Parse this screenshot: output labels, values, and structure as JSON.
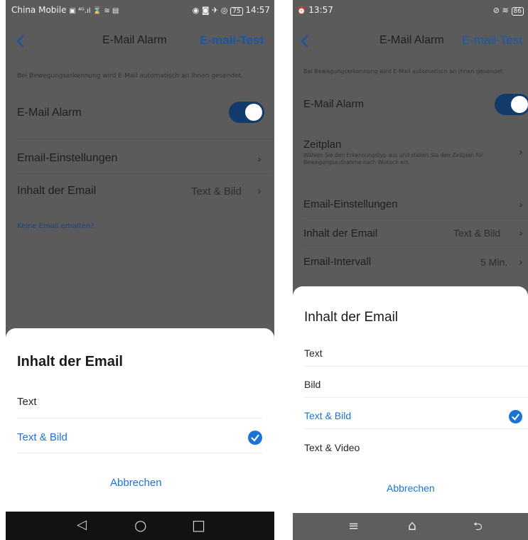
{
  "left": {
    "status": {
      "carrier": "China Mobile",
      "carrier_icons": "▣ ⁴ᴳ.ıl ⌛ ≋ ▤",
      "right_icons": "◉ ◙ ✈ ◎",
      "battery": "75",
      "time": "14:57"
    },
    "nav": {
      "title": "E-Mail Alarm",
      "action": "E-mail-Test"
    },
    "description": "Bei Bewegungserkennung wird E-Mail automatisch an Ihnen gesendet.",
    "alarm_label": "E-Mail Alarm",
    "rows": [
      {
        "label": "Email-Einstellungen",
        "value": ""
      },
      {
        "label": "Inhalt der Email",
        "value": "Text & Bild"
      }
    ],
    "link": "Keine Email erhalten?",
    "sheet": {
      "title": "Inhalt der Email",
      "options": [
        {
          "label": "Text",
          "selected": false
        },
        {
          "label": "Text & Bild",
          "selected": true
        }
      ],
      "cancel": "Abbrechen"
    },
    "sysnav": {
      "back": "◁",
      "home": "○",
      "recent": "□"
    }
  },
  "right": {
    "status": {
      "time": "13:57",
      "right_icons": "⊘ ≋",
      "battery": "86"
    },
    "nav": {
      "title": "E-Mail Alarm",
      "action": "E-mail-Test"
    },
    "description": "Bei Bewegungserkennung wird E-Mail automatisch an Ihnen gesendet.",
    "alarm_label": "E-Mail Alarm",
    "schedule": {
      "label": "Zeitplan",
      "subtitle": "Wählen Sie den Erkennungstyp aus und stellen Sie den Zeitplan für Bewegungsaufnahme nach Wunsch ein."
    },
    "rows": [
      {
        "label": "Email-Einstellungen",
        "value": ""
      },
      {
        "label": "Inhalt der Email",
        "value": "Text & Bild"
      },
      {
        "label": "Email-Intervall",
        "value": "5 Min."
      }
    ],
    "sheet": {
      "title": "Inhalt der Email",
      "options": [
        {
          "label": "Text",
          "selected": false
        },
        {
          "label": "Bild",
          "selected": false
        },
        {
          "label": "Text & Bild",
          "selected": true
        },
        {
          "label": "Text & Video",
          "selected": false
        }
      ],
      "cancel": "Abbrechen"
    },
    "sysnav": {
      "menu": "≡",
      "home": "⌂",
      "back": "⮌"
    }
  },
  "colors": {
    "overlay_bg": "#5b5b5b",
    "accent": "#1a73d6",
    "accent_dim": "#123a6a",
    "sysnav_left": "#121212",
    "sysnav_right": "#5e5e5e"
  }
}
